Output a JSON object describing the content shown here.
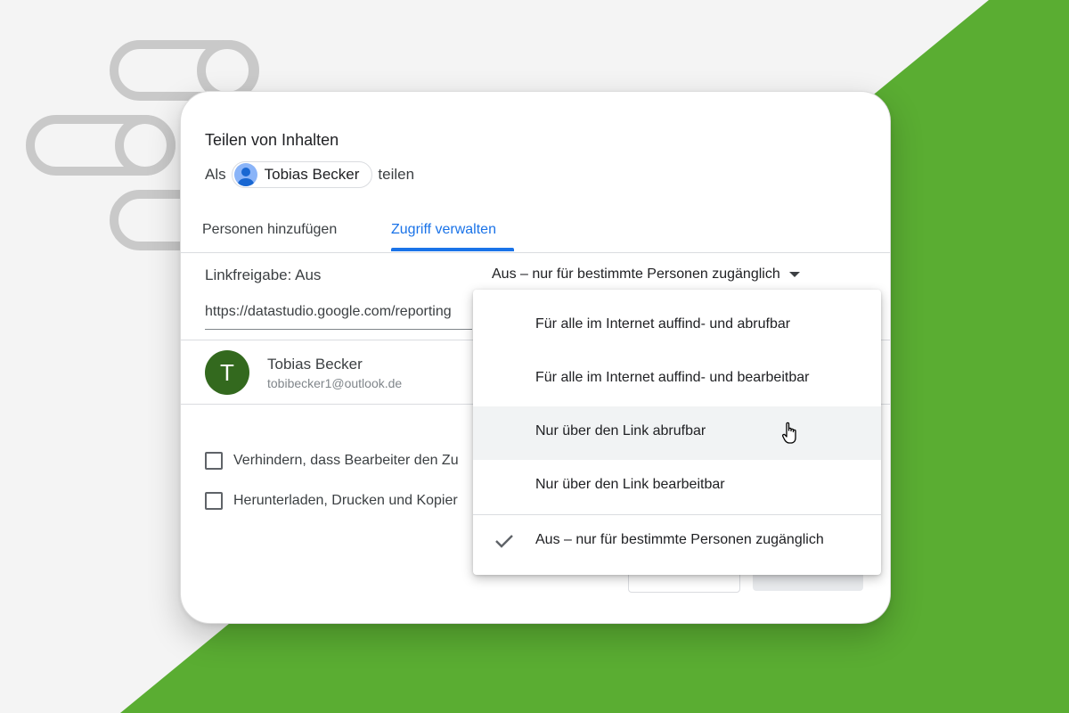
{
  "dialog": {
    "title": "Teilen von Inhalten",
    "share_as_prefix": "Als",
    "share_as_user": "Tobias Becker",
    "share_as_suffix": "teilen"
  },
  "tabs": [
    {
      "label": "Personen hinzufügen",
      "active": false
    },
    {
      "label": "Zugriff verwalten",
      "active": true
    }
  ],
  "link_sharing": {
    "label": "Linkfreigabe: Aus",
    "current_mode": "Aus – nur für bestimmte Personen zugänglich",
    "url": "https://datastudio.google.com/reporting"
  },
  "user": {
    "initial": "T",
    "name": "Tobias Becker",
    "email": "tobibecker1@outlook.de"
  },
  "options": [
    {
      "label": "Verhindern, dass Bearbeiter den Zu",
      "checked": false
    },
    {
      "label": "Herunterladen, Drucken und Kopier",
      "checked": false
    }
  ],
  "dropdown": {
    "items": [
      {
        "label": "Für alle im Internet auffind- und abrufbar"
      },
      {
        "label": "Für alle im Internet auffind- und bearbeitbar"
      },
      {
        "label": "Nur über den Link abrufbar",
        "hovered": true
      },
      {
        "label": "Nur über den Link bearbeitbar"
      },
      {
        "label": "Aus – nur für bestimmte Personen zugänglich",
        "selected": true
      }
    ]
  },
  "colors": {
    "accent": "#1a73e8",
    "background_green": "#5aad32",
    "avatar_green": "#33691e"
  },
  "icons": [
    "person-avatar-icon",
    "chevron-down-icon",
    "checkbox-icon",
    "check-icon",
    "hand-pointer-cursor-icon"
  ]
}
